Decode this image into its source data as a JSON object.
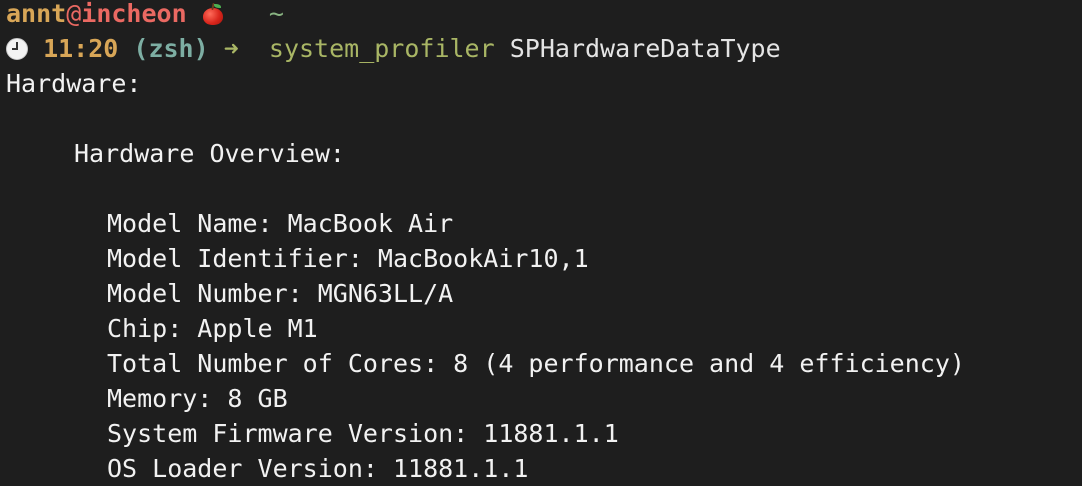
{
  "prompt": {
    "user": "annt",
    "at": "@",
    "host": "incheon",
    "apple_icon": "red-apple-emoji",
    "cwd": "~"
  },
  "command_line": {
    "clock_icon": "clock-emoji",
    "time": "11:20",
    "shell": "(zsh)",
    "arrow": "➜",
    "command": "system_profiler",
    "argument": "SPHardwareDataType"
  },
  "output": {
    "heading": "Hardware:",
    "section": "Hardware Overview:",
    "lines": [
      "Model Name: MacBook Air",
      "Model Identifier: MacBookAir10,1",
      "Model Number: MGN63LL/A",
      "Chip: Apple M1",
      "Total Number of Cores: 8 (4 performance and 4 efficiency)",
      "Memory: 8 GB",
      "System Firmware Version: 11881.1.1",
      "OS Loader Version: 11881.1.1"
    ]
  },
  "colors": {
    "background": "#1e1e1e",
    "foreground": "#f2f2f2",
    "user": "#d8a657",
    "host": "#ea6962",
    "cwd": "#89b482",
    "time": "#d8a657",
    "shell": "#7daea3",
    "command": "#a9b665"
  }
}
